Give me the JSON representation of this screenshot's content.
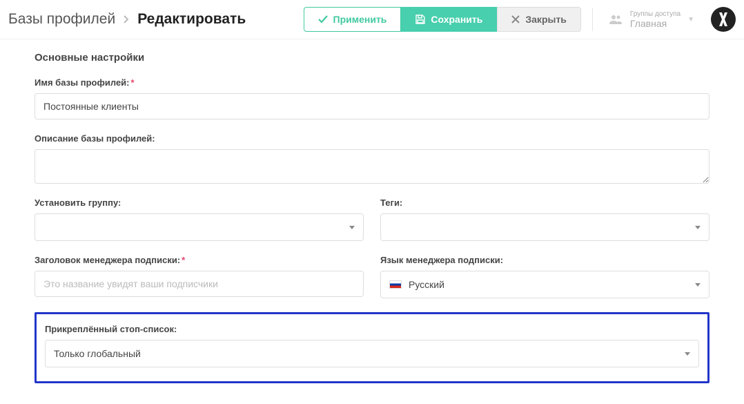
{
  "breadcrumb": {
    "parent": "Базы профилей",
    "current": "Редактировать"
  },
  "buttons": {
    "apply": "Применить",
    "save": "Сохранить",
    "close": "Закрыть"
  },
  "access": {
    "label": "Группы доступа",
    "value": "Главная"
  },
  "section_title": "Основные настройки",
  "fields": {
    "name": {
      "label": "Имя базы профилей:",
      "value": "Постоянные клиенты"
    },
    "description": {
      "label": "Описание базы профилей:",
      "value": ""
    },
    "group": {
      "label": "Установить группу:",
      "value": ""
    },
    "tags": {
      "label": "Теги:",
      "value": ""
    },
    "manager_title": {
      "label": "Заголовок менеджера подписки:",
      "placeholder": "Это название увидят ваши подписчики",
      "value": ""
    },
    "manager_lang": {
      "label": "Язык менеджера подписки:",
      "value": "Русский"
    },
    "stoplist": {
      "label": "Прикреплённый стоп-список:",
      "value": "Только глобальный"
    }
  }
}
